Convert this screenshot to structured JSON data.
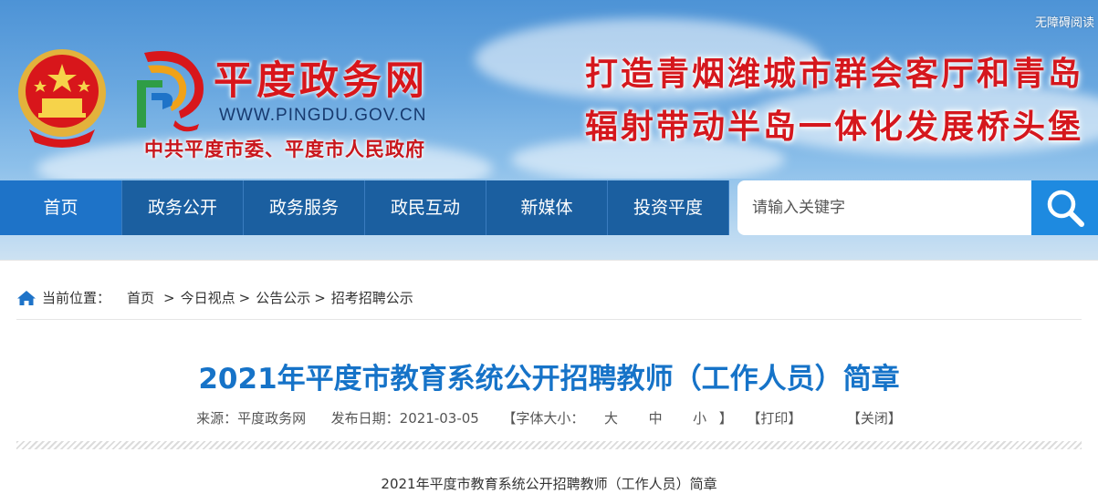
{
  "header": {
    "accessibility_label": "无障碍阅读",
    "site_name": "平度政务网",
    "site_url": "WWW.PINGDU.GOV.CN",
    "organization": "中共平度市委、平度市人民政府",
    "slogan_line1": "打造青烟潍城市群会客厅和青岛",
    "slogan_line2": "辐射带动半岛一体化发展桥头堡"
  },
  "nav": {
    "items": [
      {
        "label": "首页"
      },
      {
        "label": "政务公开"
      },
      {
        "label": "政务服务"
      },
      {
        "label": "政民互动"
      },
      {
        "label": "新媒体"
      },
      {
        "label": "投资平度"
      }
    ]
  },
  "search": {
    "placeholder": "请输入关键字"
  },
  "breadcrumb": {
    "label": "当前位置：",
    "items": [
      "首页",
      "今日视点",
      "公告公示",
      "招考招聘公示"
    ],
    "separator": ">"
  },
  "article": {
    "title": "2021年平度市教育系统公开招聘教师（工作人员）简章",
    "source": "来源：平度政务网",
    "date": "发布日期：2021-03-05",
    "font_size_label": "【字体大小：",
    "font_large": "大",
    "font_medium": "中",
    "font_small": "小",
    "font_size_close": "】",
    "print": "【打印】",
    "close": "【关闭】",
    "body_first_line": "2021年平度市教育系统公开招聘教师（工作人员）简章"
  },
  "colors": {
    "nav_bg": "#1b5fa0",
    "nav_active": "#1e73c8",
    "search_button": "#1e8ae0",
    "title_blue": "#1673c8",
    "brand_red": "#d8161b"
  }
}
